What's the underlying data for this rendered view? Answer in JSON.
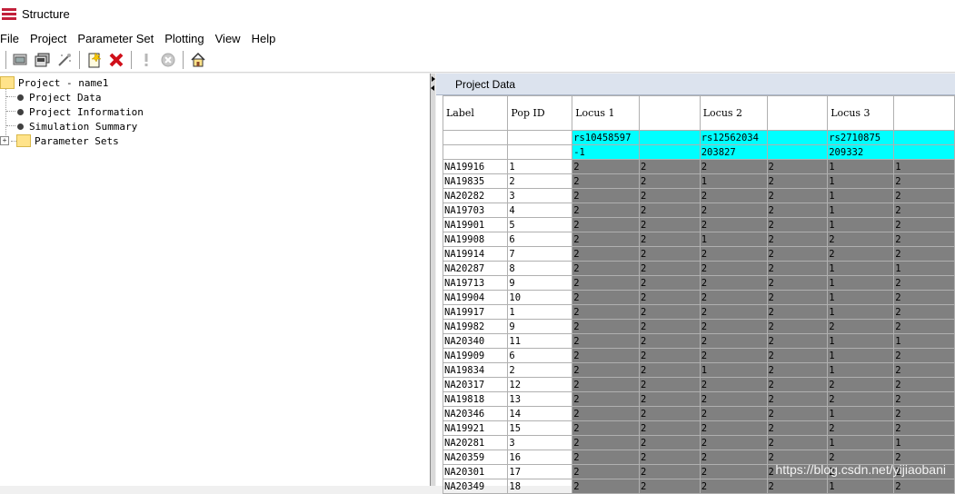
{
  "window": {
    "title": "Structure"
  },
  "menu": [
    "File",
    "Project",
    "Parameter Set",
    "Plotting",
    "View",
    "Help"
  ],
  "toolbar": {
    "buttons": [
      "open-project-icon",
      "save-project-icon",
      "wizard-icon",
      "new-file-icon",
      "delete-icon",
      "exclamation-icon",
      "stop-icon",
      "home-icon"
    ]
  },
  "tree": {
    "root": "Project - name1",
    "children": [
      "Project Data",
      "Project Information",
      "Simulation Summary"
    ],
    "folder": "Parameter Sets"
  },
  "data_pane": {
    "title": "Project Data",
    "headers": [
      "Label",
      "Pop ID",
      "Locus 1",
      "",
      "Locus 2",
      "",
      "Locus 3",
      ""
    ],
    "marker_names": [
      "",
      "",
      "rs10458597",
      "",
      "rs12562034",
      "",
      "rs2710875",
      ""
    ],
    "positions": [
      "",
      "",
      "-1",
      "",
      "203827",
      "",
      "209332",
      ""
    ],
    "rows": [
      [
        "NA19916",
        "1",
        "2",
        "2",
        "2",
        "2",
        "1",
        "1"
      ],
      [
        "NA19835",
        "2",
        "2",
        "2",
        "1",
        "2",
        "1",
        "2"
      ],
      [
        "NA20282",
        "3",
        "2",
        "2",
        "2",
        "2",
        "1",
        "2"
      ],
      [
        "NA19703",
        "4",
        "2",
        "2",
        "2",
        "2",
        "1",
        "2"
      ],
      [
        "NA19901",
        "5",
        "2",
        "2",
        "2",
        "2",
        "1",
        "2"
      ],
      [
        "NA19908",
        "6",
        "2",
        "2",
        "1",
        "2",
        "2",
        "2"
      ],
      [
        "NA19914",
        "7",
        "2",
        "2",
        "2",
        "2",
        "2",
        "2"
      ],
      [
        "NA20287",
        "8",
        "2",
        "2",
        "2",
        "2",
        "1",
        "1"
      ],
      [
        "NA19713",
        "9",
        "2",
        "2",
        "2",
        "2",
        "1",
        "2"
      ],
      [
        "NA19904",
        "10",
        "2",
        "2",
        "2",
        "2",
        "1",
        "2"
      ],
      [
        "NA19917",
        "1",
        "2",
        "2",
        "2",
        "2",
        "1",
        "2"
      ],
      [
        "NA19982",
        "9",
        "2",
        "2",
        "2",
        "2",
        "2",
        "2"
      ],
      [
        "NA20340",
        "11",
        "2",
        "2",
        "2",
        "2",
        "1",
        "1"
      ],
      [
        "NA19909",
        "6",
        "2",
        "2",
        "2",
        "2",
        "1",
        "2"
      ],
      [
        "NA19834",
        "2",
        "2",
        "2",
        "1",
        "2",
        "1",
        "2"
      ],
      [
        "NA20317",
        "12",
        "2",
        "2",
        "2",
        "2",
        "2",
        "2"
      ],
      [
        "NA19818",
        "13",
        "2",
        "2",
        "2",
        "2",
        "2",
        "2"
      ],
      [
        "NA20346",
        "14",
        "2",
        "2",
        "2",
        "2",
        "1",
        "2"
      ],
      [
        "NA19921",
        "15",
        "2",
        "2",
        "2",
        "2",
        "2",
        "2"
      ],
      [
        "NA20281",
        "3",
        "2",
        "2",
        "2",
        "2",
        "1",
        "1"
      ],
      [
        "NA20359",
        "16",
        "2",
        "2",
        "2",
        "2",
        "2",
        "2"
      ],
      [
        "NA20301",
        "17",
        "2",
        "2",
        "2",
        "2",
        "2",
        "2"
      ],
      [
        "NA20349",
        "18",
        "2",
        "2",
        "2",
        "2",
        "1",
        "2"
      ]
    ]
  },
  "watermark": "https://blog.csdn.net/yijiaobani",
  "colors": {
    "marker_row": "#00ffff",
    "genotype_cells": "#808080",
    "pane_header": "#dce3ee"
  }
}
